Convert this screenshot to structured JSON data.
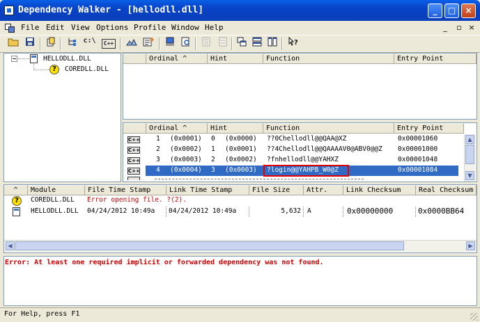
{
  "window": {
    "title": "Dependency Walker - [hellodll.dll]",
    "min_glyph": "_",
    "max_glyph": "□",
    "close_glyph": "×"
  },
  "menu": {
    "items": [
      "File",
      "Edit",
      "View",
      "Options",
      "Profile",
      "Window",
      "Help"
    ],
    "mdi_min": "_",
    "mdi_restore": "▫",
    "mdi_close": "×"
  },
  "toolbar": {
    "c_label": "c:\\",
    "cpp_label": "C++"
  },
  "tree": {
    "root": "HELLODLL.DLL",
    "child": "COREDLL.DLL",
    "expander": "−",
    "q_glyph": "?"
  },
  "parent_imports": {
    "headers": [
      "",
      "Ordinal ^",
      "Hint",
      "Function",
      "Entry Point"
    ]
  },
  "exports": {
    "headers": [
      "",
      "Ordinal ^",
      "Hint",
      "Function",
      "Entry Point"
    ],
    "icon_label": "C++",
    "rows": [
      {
        "num": "1",
        "ordinal": "(0x0001)",
        "hint_num": "0",
        "hint": "(0x0000)",
        "function": "??0Chellodll@@QAA@XZ",
        "entry": "0x00001060",
        "selected": false
      },
      {
        "num": "2",
        "ordinal": "(0x0002)",
        "hint_num": "1",
        "hint": "(0x0001)",
        "function": "??4Chellodll@@QAAAAV0@ABV0@@Z",
        "entry": "0x00001000",
        "selected": false
      },
      {
        "num": "3",
        "ordinal": "(0x0003)",
        "hint_num": "2",
        "hint": "(0x0002)",
        "function": "?fnhellodll@@YAHXZ",
        "entry": "0x00001048",
        "selected": false
      },
      {
        "num": "4",
        "ordinal": "(0x0004)",
        "hint_num": "3",
        "hint": "(0x0003)",
        "function": "?login@@YAHPB_W0@Z",
        "entry": "0x00001084",
        "selected": true
      }
    ]
  },
  "modules": {
    "headers": [
      "^",
      "Module",
      "File Time Stamp",
      "Link Time Stamp",
      "File Size",
      "Attr.",
      "Link Checksum",
      "Real Checksum"
    ],
    "rows": [
      {
        "module": "COREDLL.DLL",
        "file_ts": "Error opening file. ?(2).",
        "link_ts": "",
        "size": "",
        "attr": "",
        "link_cs": "",
        "real_cs": "",
        "error": true
      },
      {
        "module": "HELLODLL.DLL",
        "file_ts": "04/24/2012  10:49a",
        "link_ts": "04/24/2012  10:49a",
        "size": "5,632",
        "attr": "A",
        "link_cs": "0x00000000",
        "real_cs": "0x0000BB64",
        "error": false
      }
    ]
  },
  "log": {
    "message": "Error: At least one required implicit or forwarded dependency was not found."
  },
  "status": {
    "text": "For Help, press F1"
  },
  "colors": {
    "selection": "#316ac5",
    "highlight_box": "#e00000",
    "error_text": "#d00000"
  }
}
